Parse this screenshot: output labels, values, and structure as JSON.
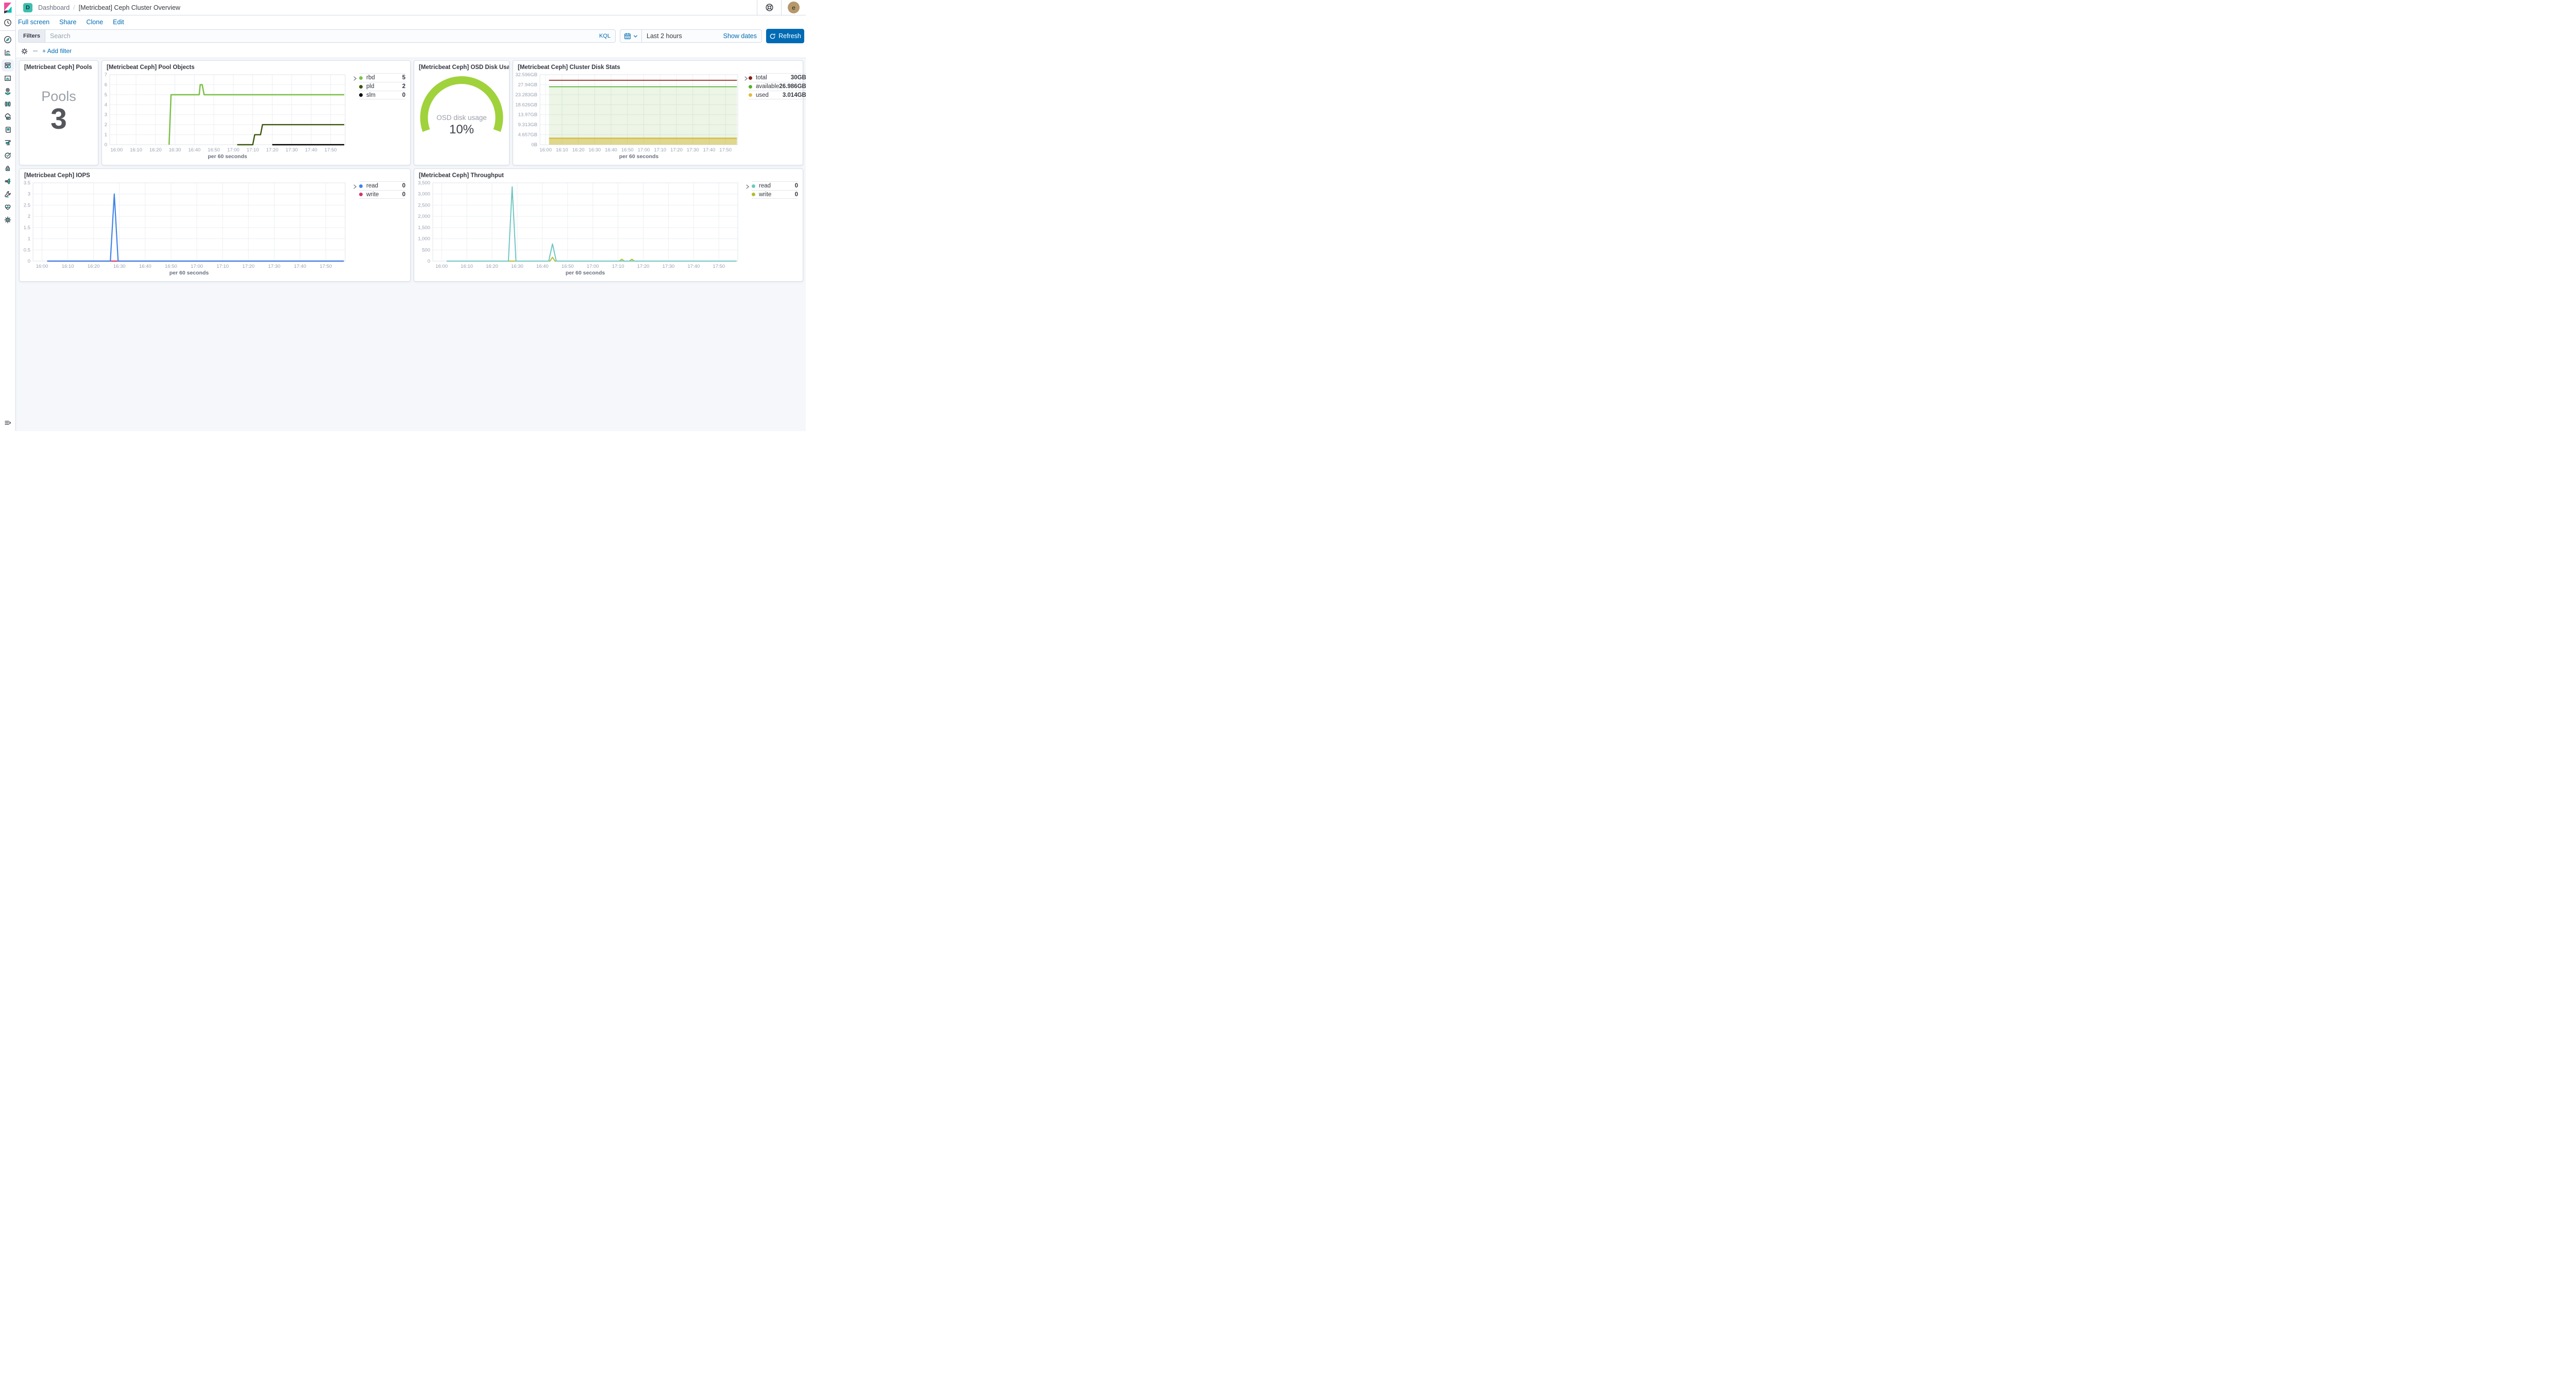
{
  "header": {
    "badge": "D",
    "breadcrumb": "Dashboard",
    "separator": "/",
    "title": "[Metricbeat] Ceph Cluster Overview",
    "avatar_initial": "e"
  },
  "menu": {
    "items": [
      "Full screen",
      "Share",
      "Clone",
      "Edit"
    ]
  },
  "query_bar": {
    "filters_label": "Filters",
    "search_placeholder": "Search",
    "kql_label": "KQL",
    "time_value": "Last 2 hours",
    "show_dates_label": "Show dates",
    "refresh_label": "Refresh"
  },
  "filter_bar": {
    "add_filter_label": "+ Add filter"
  },
  "panels": {
    "pools": {
      "title": "[Metricbeat Ceph] Pools",
      "metric_label": "Pools",
      "metric_value": "3"
    },
    "pool_objects": {
      "title": "[Metricbeat Ceph] Pool Objects",
      "legend": [
        {
          "label": "rbd",
          "value": "5",
          "color": "#7dc24b"
        },
        {
          "label": "pld",
          "value": "2",
          "color": "#3a550e"
        },
        {
          "label": "slm",
          "value": "0",
          "color": "#000000"
        }
      ]
    },
    "osd": {
      "title": "[Metricbeat Ceph] OSD Disk Usage",
      "gauge_label": "OSD disk usage",
      "gauge_value": "10%",
      "gauge_color": "#a0d23c"
    },
    "cluster_disk": {
      "title": "[Metricbeat Ceph] Cluster Disk Stats",
      "legend": [
        {
          "label": "total",
          "value": "30GB",
          "color": "#8a1a10"
        },
        {
          "label": "available",
          "value": "26.986GB",
          "color": "#54b32b"
        },
        {
          "label": "used",
          "value": "3.014GB",
          "color": "#e0bc3f"
        }
      ]
    },
    "iops": {
      "title": "[Metricbeat Ceph] IOPS",
      "legend": [
        {
          "label": "read",
          "value": "0",
          "color": "#3f83e8"
        },
        {
          "label": "write",
          "value": "0",
          "color": "#d0356d"
        }
      ]
    },
    "throughput": {
      "title": "[Metricbeat Ceph] Throughput",
      "legend": [
        {
          "label": "read",
          "value": "0",
          "color": "#6ec6c2"
        },
        {
          "label": "write",
          "value": "0",
          "color": "#b3bd2d"
        }
      ]
    }
  },
  "chart_data": [
    {
      "type": "metric",
      "mount": "pools-metric",
      "title": "Pools",
      "value": 3
    },
    {
      "type": "line",
      "mount": "pool-objects",
      "title": "[Metricbeat Ceph] Pool Objects",
      "x_label": "per 60 seconds",
      "x_domain": [
        -3.5,
        117.5
      ],
      "x_tick_labels": [
        "16:00",
        "16:10",
        "16:20",
        "16:30",
        "16:40",
        "16:50",
        "17:00",
        "17:10",
        "17:20",
        "17:30",
        "17:40",
        "17:50"
      ],
      "y_max": 7,
      "y_ticks": [
        {
          "v": 0,
          "label": "0"
        },
        {
          "v": 1,
          "label": "1"
        },
        {
          "v": 2,
          "label": "2"
        },
        {
          "v": 3,
          "label": "3"
        },
        {
          "v": 4,
          "label": "4"
        },
        {
          "v": 5,
          "label": "5"
        },
        {
          "v": 6,
          "label": "6"
        },
        {
          "v": 7,
          "label": "7"
        }
      ],
      "series": [
        {
          "name": "rbd",
          "color": "#7dc24b",
          "width": 2.6,
          "points": [
            [
              27,
              0
            ],
            [
              28,
              5
            ],
            [
              42.5,
              5
            ],
            [
              43,
              6
            ],
            [
              44,
              6
            ],
            [
              45,
              5
            ],
            [
              117,
              5
            ]
          ]
        },
        {
          "name": "pld",
          "color": "#3a550e",
          "width": 2.4,
          "points": [
            [
              62,
              0
            ],
            [
              70,
              0
            ],
            [
              71,
              1
            ],
            [
              74,
              1
            ],
            [
              75,
              2
            ],
            [
              117,
              2
            ]
          ]
        },
        {
          "name": "slm",
          "color": "#000000",
          "width": 2.4,
          "points": [
            [
              80,
              0
            ],
            [
              117,
              0
            ]
          ]
        }
      ]
    },
    {
      "type": "gauge",
      "mount": "osd-gauge",
      "label": "OSD disk usage",
      "value": 10,
      "min": 0,
      "max": 100,
      "unit": "%",
      "color": "#a0d23c"
    },
    {
      "type": "line",
      "mount": "cluster-disk",
      "title": "[Metricbeat Ceph] Cluster Disk Stats",
      "x_label": "per 60 seconds",
      "x_domain": [
        -3.5,
        117.5
      ],
      "x_tick_labels": [
        "16:00",
        "16:10",
        "16:20",
        "16:30",
        "16:40",
        "16:50",
        "17:00",
        "17:10",
        "17:20",
        "17:30",
        "17:40",
        "17:50"
      ],
      "y_max": 32.596,
      "y_ticks": [
        {
          "v": 0,
          "label": "0B"
        },
        {
          "v": 4.657,
          "label": "4.657GB"
        },
        {
          "v": 9.313,
          "label": "9.313GB"
        },
        {
          "v": 13.97,
          "label": "13.97GB"
        },
        {
          "v": 18.626,
          "label": "18.626GB"
        },
        {
          "v": 23.283,
          "label": "23.283GB"
        },
        {
          "v": 27.94,
          "label": "27.94GB"
        },
        {
          "v": 32.596,
          "label": "32.596GB"
        }
      ],
      "series": [
        {
          "name": "available",
          "color": "#4cab28",
          "width": 1.6,
          "fill": "rgba(108,179,63,0.13)",
          "points": [
            [
              2,
              26.986
            ],
            [
              117,
              26.986
            ]
          ]
        },
        {
          "name": "used",
          "color": "#d3b93c",
          "width": 2.2,
          "fill": "rgba(213,189,70,0.55)",
          "points": [
            [
              2,
              3.014
            ],
            [
              117,
              3.014
            ]
          ]
        },
        {
          "name": "total",
          "color": "#8a1a10",
          "width": 1.6,
          "points": [
            [
              2,
              30
            ],
            [
              117,
              30
            ]
          ]
        }
      ]
    },
    {
      "type": "line",
      "mount": "iops",
      "title": "[Metricbeat Ceph] IOPS",
      "x_label": "per 60 seconds",
      "x_domain": [
        -3.5,
        117.5
      ],
      "x_tick_labels": [
        "16:00",
        "16:10",
        "16:20",
        "16:30",
        "16:40",
        "16:50",
        "17:00",
        "17:10",
        "17:20",
        "17:30",
        "17:40",
        "17:50"
      ],
      "y_max": 3.5,
      "y_ticks": [
        {
          "v": 0,
          "label": "0"
        },
        {
          "v": 0.5,
          "label": "0.5"
        },
        {
          "v": 1,
          "label": "1"
        },
        {
          "v": 1.5,
          "label": "1.5"
        },
        {
          "v": 2,
          "label": "2"
        },
        {
          "v": 2.5,
          "label": "2.5"
        },
        {
          "v": 3,
          "label": "3"
        },
        {
          "v": 3.5,
          "label": "3.5"
        }
      ],
      "series": [
        {
          "name": "write",
          "color": "#d0356d",
          "width": 2.2,
          "points": [
            [
              2,
              0
            ],
            [
              117,
              0
            ]
          ]
        },
        {
          "name": "read",
          "color": "#3f83e8",
          "width": 2.2,
          "points": [
            [
              2,
              0
            ],
            [
              26.5,
              0
            ],
            [
              28,
              3
            ],
            [
              29.5,
              0
            ],
            [
              117,
              0
            ]
          ]
        }
      ]
    },
    {
      "type": "line",
      "mount": "throughput",
      "title": "[Metricbeat Ceph] Throughput",
      "x_label": "per 60 seconds",
      "x_domain": [
        -3.5,
        117.5
      ],
      "x_tick_labels": [
        "16:00",
        "16:10",
        "16:20",
        "16:30",
        "16:40",
        "16:50",
        "17:00",
        "17:10",
        "17:20",
        "17:30",
        "17:40",
        "17:50"
      ],
      "y_max": 3500,
      "y_ticks": [
        {
          "v": 0,
          "label": "0"
        },
        {
          "v": 500,
          "label": "500"
        },
        {
          "v": 1000,
          "label": "1,000"
        },
        {
          "v": 1500,
          "label": "1,500"
        },
        {
          "v": 2000,
          "label": "2,000"
        },
        {
          "v": 2500,
          "label": "2,500"
        },
        {
          "v": 3000,
          "label": "3,000"
        },
        {
          "v": 3500,
          "label": "3,500"
        }
      ],
      "series": [
        {
          "name": "write",
          "color": "#b3bd2d",
          "width": 2,
          "points": [
            [
              2,
              0
            ],
            [
              43,
              0
            ],
            [
              44,
              170
            ],
            [
              45,
              0
            ],
            [
              70.5,
              0
            ],
            [
              71.5,
              85
            ],
            [
              72.5,
              0
            ],
            [
              74.5,
              0
            ],
            [
              75.5,
              85
            ],
            [
              76.5,
              0
            ],
            [
              117,
              0
            ]
          ]
        },
        {
          "name": "read",
          "color": "#6ec6c2",
          "width": 2,
          "points": [
            [
              2,
              0
            ],
            [
              26.5,
              0
            ],
            [
              28,
              3320
            ],
            [
              29.5,
              0
            ],
            [
              42.5,
              0
            ],
            [
              44,
              770
            ],
            [
              45.5,
              0
            ],
            [
              117,
              0
            ]
          ]
        }
      ]
    }
  ]
}
